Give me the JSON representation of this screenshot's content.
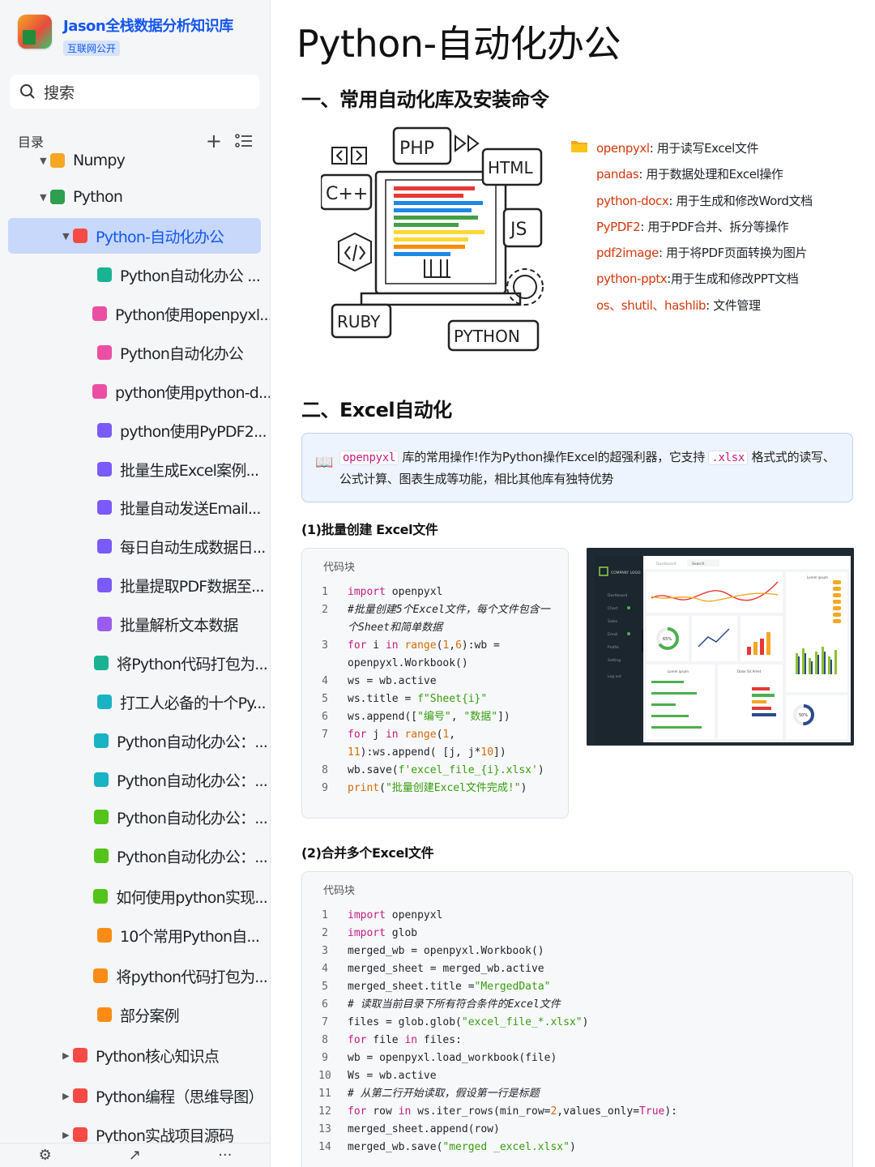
{
  "sidebar": {
    "brand_title": "Jason全栈数据分析知识库",
    "brand_badge": "互联网公开",
    "search_label": "搜索",
    "toc_label": "目录",
    "items": [
      {
        "label": "Numpy",
        "level": 1,
        "color": "#f5a623"
      },
      {
        "label": "Python",
        "level": 1,
        "color": "#2e9e4f"
      },
      {
        "label": "Python-自动化办公",
        "level": 2,
        "color": "#f54a45"
      },
      {
        "label": "Python自动化办公 ...",
        "level": 3,
        "color": "#19b394"
      },
      {
        "label": "Python使用openpyxl...",
        "level": 3,
        "color": "#eb4fa4"
      },
      {
        "label": "Python自动化办公",
        "level": 3,
        "color": "#eb4fa4"
      },
      {
        "label": "python使用python-d...",
        "level": 3,
        "color": "#eb4fa4"
      },
      {
        "label": "python使用PyPDF2...",
        "level": 3,
        "color": "#7a5af8"
      },
      {
        "label": "批量生成Excel案例...",
        "level": 3,
        "color": "#7a5af8"
      },
      {
        "label": "批量自动发送Email...",
        "level": 3,
        "color": "#7a5af8"
      },
      {
        "label": "每日自动生成数据日...",
        "level": 3,
        "color": "#7a5af8"
      },
      {
        "label": "批量提取PDF数据至...",
        "level": 3,
        "color": "#7a5af8"
      },
      {
        "label": "批量解析文本数据",
        "level": 3,
        "color": "#9a5cf0"
      },
      {
        "label": "将Python代码打包为...",
        "level": 3,
        "color": "#19b394"
      },
      {
        "label": "打工人必备的十个Py...",
        "level": 3,
        "color": "#19b3c4"
      },
      {
        "label": "Python自动化办公：...",
        "level": 3,
        "color": "#19b3c4"
      },
      {
        "label": "Python自动化办公：...",
        "level": 3,
        "color": "#19b3c4"
      },
      {
        "label": "Python自动化办公：...",
        "level": 3,
        "color": "#52c41a"
      },
      {
        "label": "Python自动化办公：...",
        "level": 3,
        "color": "#52c41a"
      },
      {
        "label": "如何使用python实现...",
        "level": 3,
        "color": "#52c41a"
      },
      {
        "label": "10个常用Python自...",
        "level": 3,
        "color": "#fa8c16"
      },
      {
        "label": "将python代码打包为...",
        "level": 3,
        "color": "#fa8c16"
      },
      {
        "label": "部分案例",
        "level": 3,
        "color": "#fa8c16"
      },
      {
        "label": "Python核心知识点",
        "level": 2,
        "color": "#f54a45"
      },
      {
        "label": "Python编程（思维导图）",
        "level": 2,
        "color": "#f54a45"
      },
      {
        "label": "Python实战项目源码",
        "level": 2,
        "color": "#f54a45"
      }
    ]
  },
  "main": {
    "title": "Python-自动化办公",
    "section1": "一、常用自动化库及安装命令",
    "hero_labels": [
      "PHP",
      "HTML",
      "C++",
      "JS",
      "RUBY",
      "PYTHON"
    ],
    "libs": [
      {
        "name": "openpyxl",
        "desc": ": 用于读写Excel文件"
      },
      {
        "name": "pandas",
        "desc": ": 用于数据处理和Excel操作"
      },
      {
        "name": "python-docx",
        "desc": ": 用于生成和修改Word文档"
      },
      {
        "name": "PyPDF2",
        "desc": ": 用于PDF合并、拆分等操作"
      },
      {
        "name": "pdf2image",
        "desc": ": 用于将PDF页面转换为图片"
      },
      {
        "name": "python-pptx",
        "desc": ":用于生成和修改PPT文档"
      },
      {
        "name": "os、shutil、hashlib",
        "desc": ": 文件管理"
      }
    ],
    "section2": "二、Excel自动化",
    "callout": {
      "code1": "openpyxl",
      "text1": "库的常用操作!作为Python操作Excel的超强利器，它支持",
      "code2": ".xlsx",
      "text2": "格式式的读写、公式计算、图表生成等功能，相比其他库有独特优势"
    },
    "sub1": "(1)批量创建 Excel文件",
    "sub2": "(2)合并多个Excel文件",
    "code_label": "代码块",
    "dashboard": {
      "logo": "COMPANY LOGO",
      "tab": "Dashboard",
      "search": "Search",
      "logout": "Log out",
      "nav": [
        "Dashboard",
        "Chart",
        "Sales",
        "Email",
        "Profile",
        "Setting"
      ],
      "gauge1": "65%",
      "gauge2": "50%",
      "widget_label": "Lorem ipsum",
      "dolor": "Dolor Sit Amet"
    }
  }
}
